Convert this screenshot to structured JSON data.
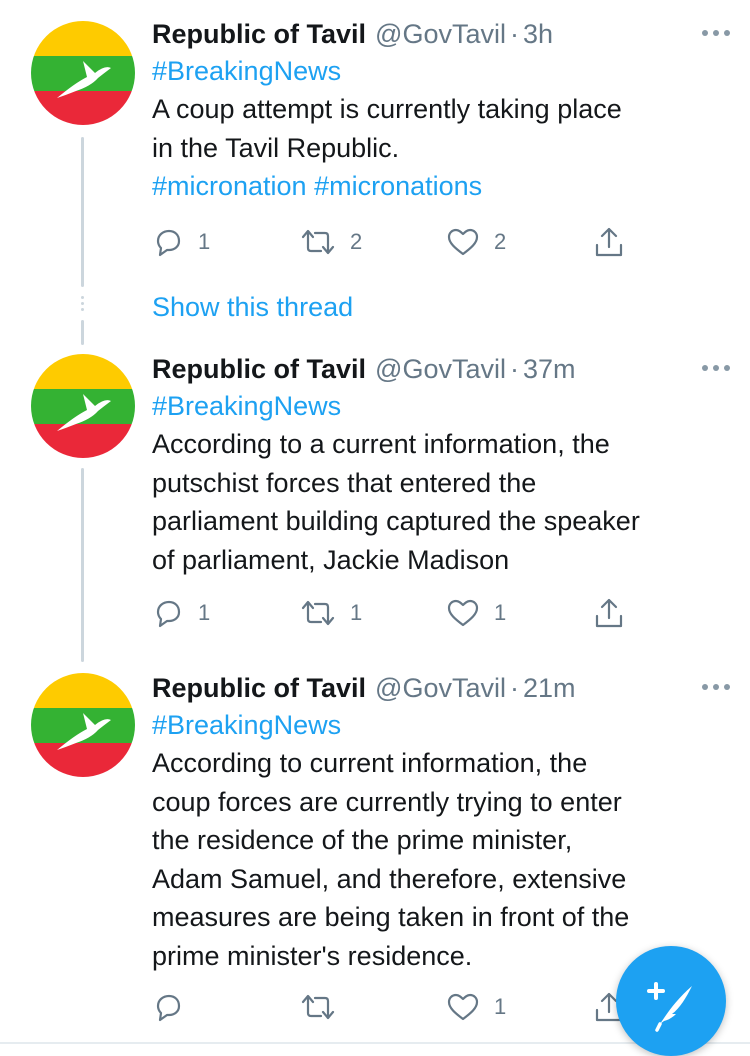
{
  "account": {
    "name": "Republic of Tavil",
    "handle": "@GovTavil",
    "separator": "·"
  },
  "avatar": {
    "flag_colors": {
      "top": "#FECB00",
      "middle": "#34B233",
      "bottom": "#EA2839",
      "bird": "#FFFFFF"
    }
  },
  "tweets": [
    {
      "time": "3h",
      "hashtag_line": "#BreakingNews",
      "text_lines": [
        "A coup attempt is currently taking place",
        "in the Tavil Republic."
      ],
      "extra_hashtags": "#micronation #micronations",
      "replies": "1",
      "retweets": "2",
      "likes": "2"
    },
    {
      "time": "37m",
      "hashtag_line": "#BreakingNews",
      "text_lines": [
        "According to a current information, the",
        "putschist forces that entered the",
        "parliament building captured the speaker",
        "of parliament, Jackie Madison"
      ],
      "replies": "1",
      "retweets": "1",
      "likes": "1"
    },
    {
      "time": "21m",
      "hashtag_line": "#BreakingNews",
      "text_lines": [
        "According to current information, the",
        "coup forces are currently trying to enter",
        "the residence of the prime minister,",
        "Adam Samuel, and therefore, extensive",
        "measures are being taken in front of the",
        "prime minister's residence."
      ],
      "replies": "",
      "retweets": "",
      "likes": "1"
    }
  ],
  "show_thread_label": "Show this thread",
  "icons": {
    "reply": "reply-icon",
    "retweet": "retweet-icon",
    "like": "heart-icon",
    "share": "share-icon",
    "more": "more-icon",
    "compose": "compose-tweet-icon"
  },
  "colors": {
    "accent": "#1DA1F2",
    "muted_text": "#657786",
    "thread_line": "#CCD6DD"
  }
}
